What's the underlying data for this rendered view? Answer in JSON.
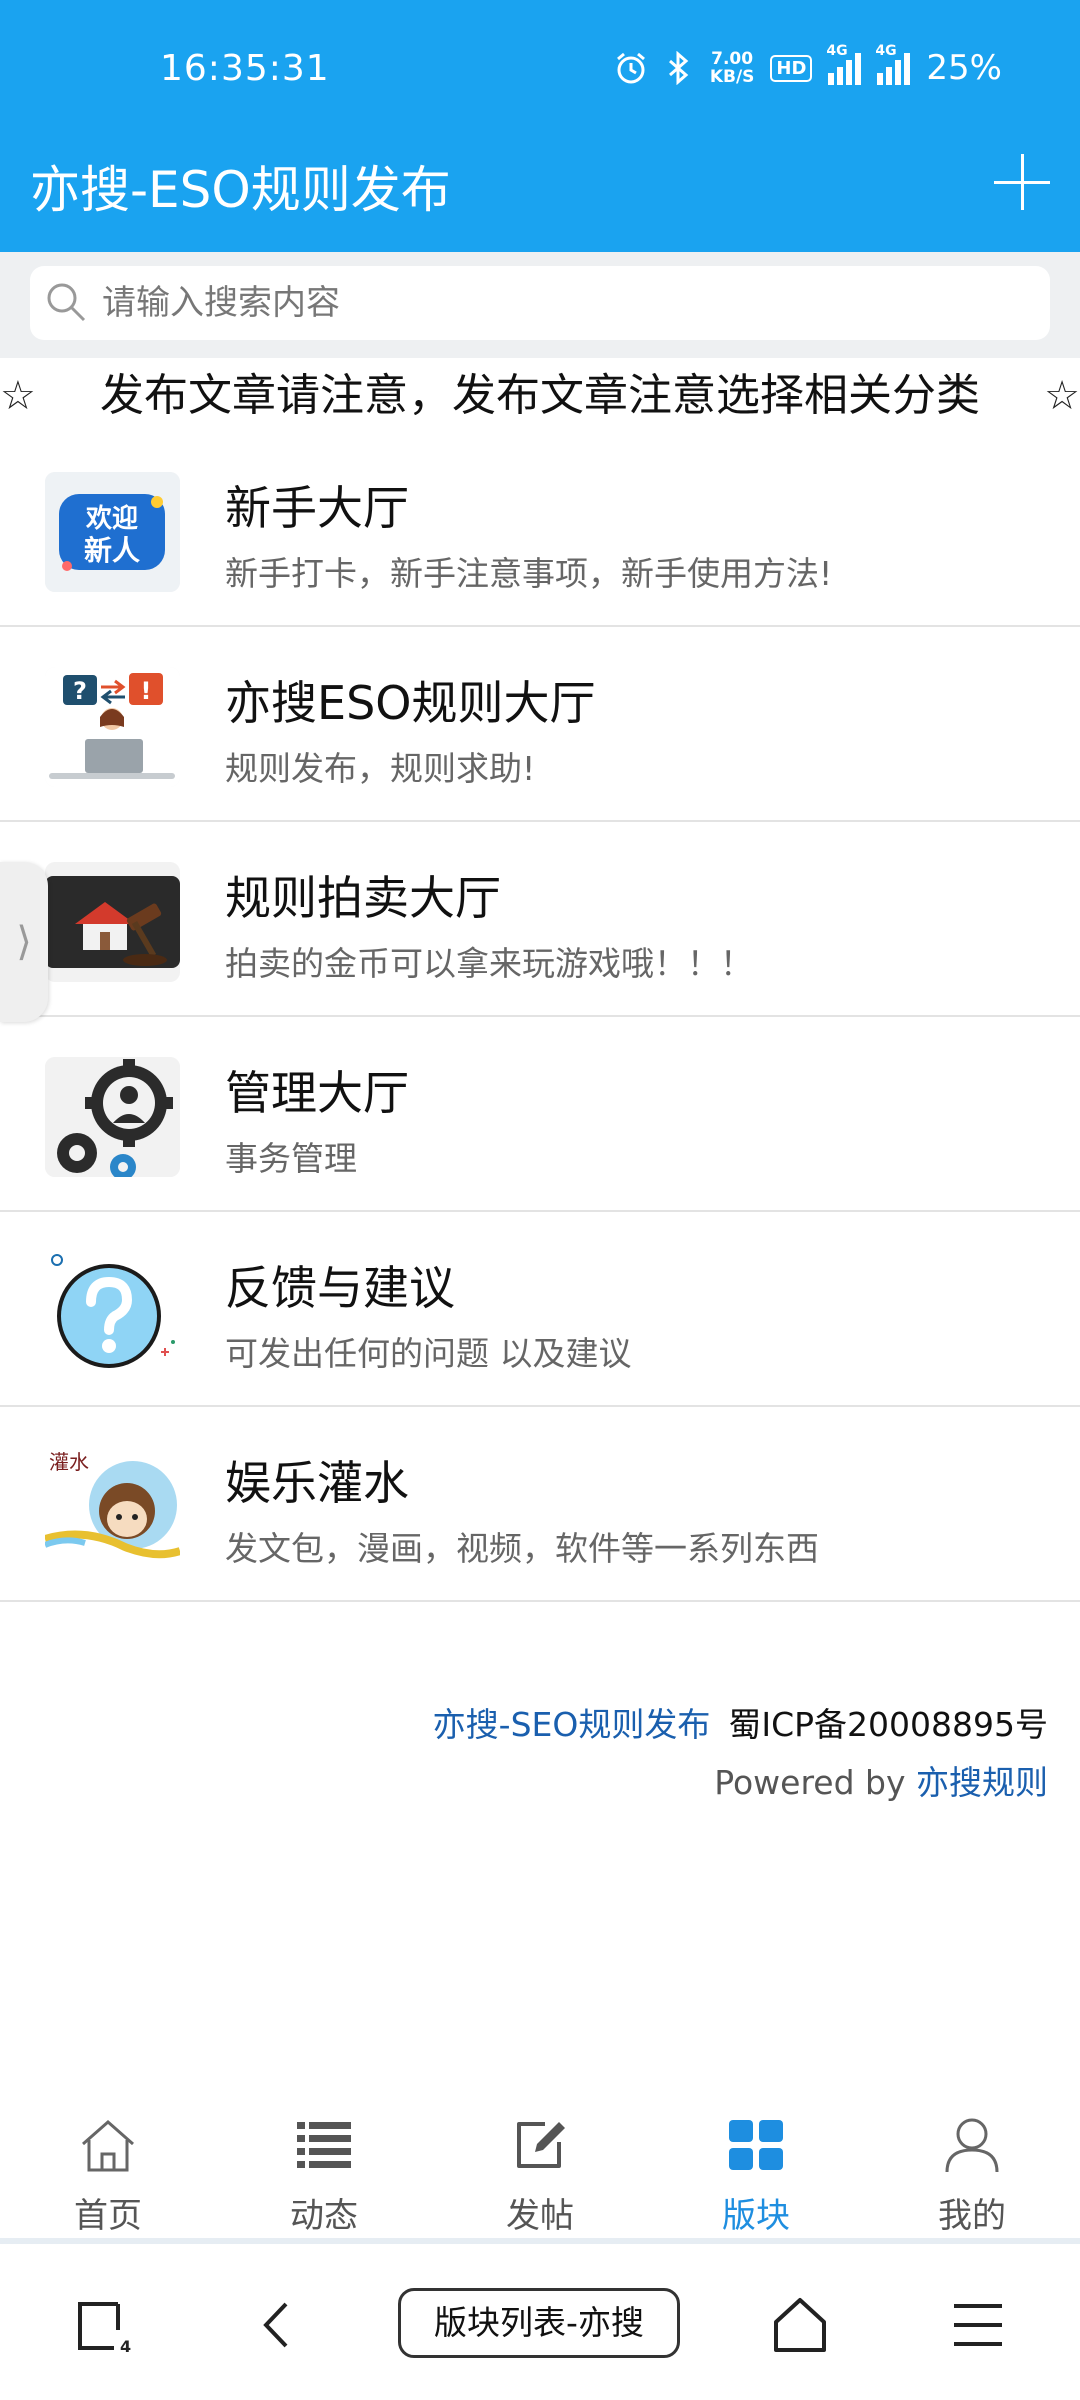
{
  "status": {
    "time": "16:35:31",
    "speed_value": "7.00",
    "speed_unit": "KB/S",
    "hd": "HD",
    "net1": "4G",
    "net2": "4G",
    "battery": "25%"
  },
  "appbar": {
    "title": "亦搜-ESO规则发布"
  },
  "search": {
    "placeholder": "请输入搜索内容"
  },
  "notice": {
    "star": "☆",
    "text": "发布文章请注意，发布文章注意选择相关分类"
  },
  "forums": [
    {
      "name": "新手大厅",
      "desc": "新手打卡，新手注意事项，新手使用方法!",
      "icon": "welcome-newbie-icon"
    },
    {
      "name": "亦搜ESO规则大厅",
      "desc": "规则发布，规则求助!",
      "icon": "question-exclaim-person-icon"
    },
    {
      "name": "规则拍卖大厅",
      "desc": "拍卖的金币可以拿来玩游戏哦！！！",
      "icon": "auction-gavel-icon"
    },
    {
      "name": "管理大厅",
      "desc": "事务管理",
      "icon": "gear-manager-icon"
    },
    {
      "name": "反馈与建议",
      "desc": "可发出任何的问题 以及建议",
      "icon": "question-bubble-icon"
    },
    {
      "name": "娱乐灌水",
      "desc": "发文包，漫画，视频，软件等一系列东西",
      "icon": "cartoon-girl-icon",
      "thumb_text": "灌水"
    }
  ],
  "side_handle": {
    "glyph": "⟩"
  },
  "footer": {
    "site": "亦搜-SEO规则发布",
    "icp": "蜀ICP备20008895号",
    "powered_prefix": "Powered by ",
    "powered_link": "亦搜规则"
  },
  "tabs": [
    {
      "label": "首页",
      "icon": "home-icon"
    },
    {
      "label": "动态",
      "icon": "list-icon"
    },
    {
      "label": "发帖",
      "icon": "edit-icon"
    },
    {
      "label": "版块",
      "icon": "grid-icon",
      "active": true
    },
    {
      "label": "我的",
      "icon": "user-icon"
    }
  ],
  "browser": {
    "tab_count": "4",
    "url_label": "版块列表-亦搜"
  },
  "colors": {
    "brand": "#1aa3f0",
    "active_tab": "#1e8ee0",
    "link": "#1a5fae"
  }
}
